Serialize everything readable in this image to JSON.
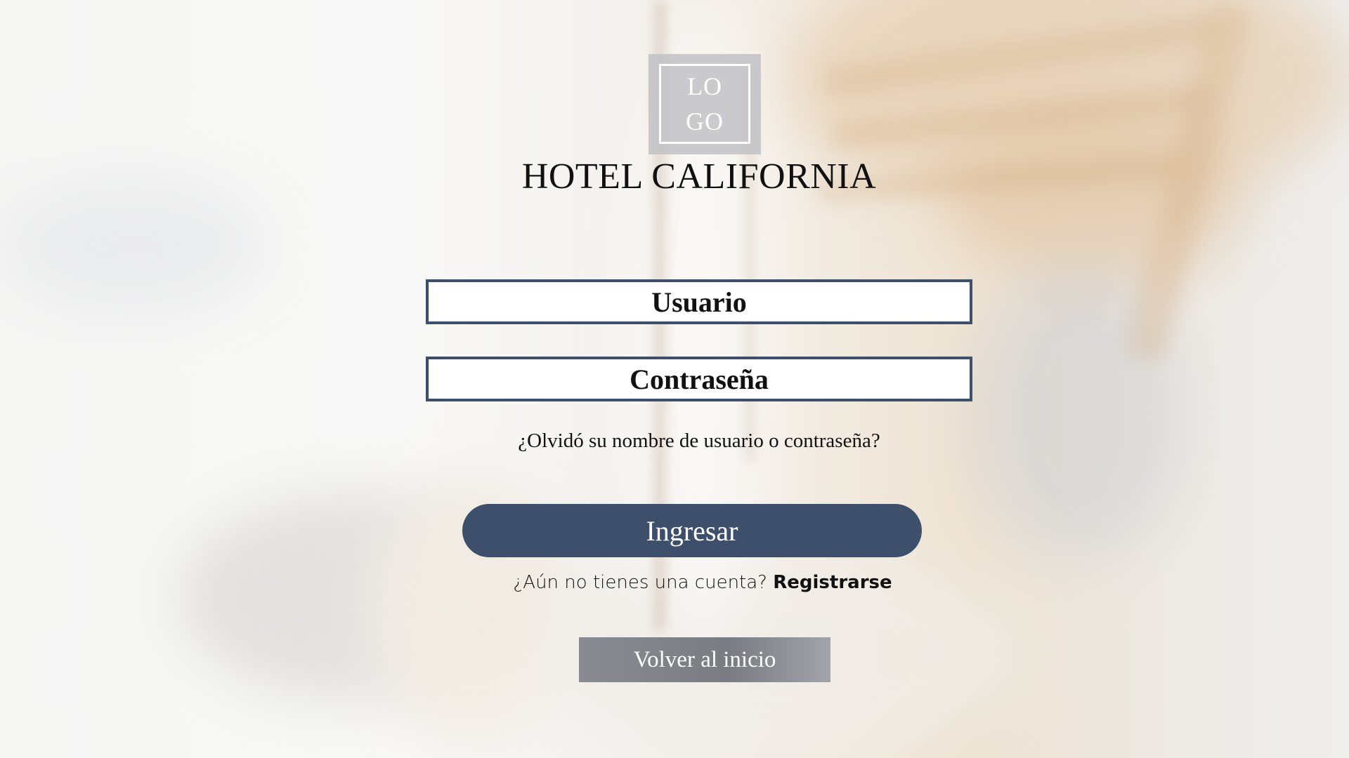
{
  "logo": {
    "text": "LOGO"
  },
  "hotel": {
    "name": "HOTEL CALIFORNIA"
  },
  "form": {
    "username_placeholder": "Usuario",
    "password_placeholder": "Contraseña",
    "forgot_link": "¿Olvidó su nombre de usuario o contraseña?",
    "login_button": "Ingresar",
    "register_prompt": "¿Aún no tienes una cuenta?",
    "register_link": "Registrarse",
    "home_button": "Volver al inicio"
  },
  "colors": {
    "primary": "#3d4f6b",
    "secondary_button": "#7f8187",
    "text": "#111111"
  }
}
